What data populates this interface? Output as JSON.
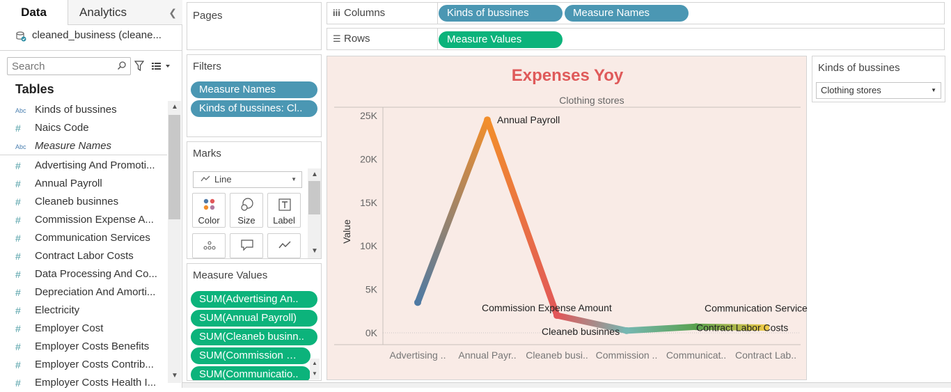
{
  "tabs": {
    "data": "Data",
    "analytics": "Analytics"
  },
  "datasource": "cleaned_business (cleane...",
  "search": {
    "placeholder": "Search"
  },
  "tables_heading": "Tables",
  "fields": [
    {
      "type": "abc",
      "label": "Kinds of bussines",
      "italic": false
    },
    {
      "type": "measure",
      "label": "Naics Code",
      "italic": false
    },
    {
      "type": "abc",
      "label": "Measure Names",
      "italic": true
    },
    {
      "type": "measure",
      "label": "Advertising And Promoti...",
      "italic": false
    },
    {
      "type": "measure",
      "label": "Annual Payroll",
      "italic": false
    },
    {
      "type": "measure",
      "label": "Cleaneb businnes",
      "italic": false
    },
    {
      "type": "measure",
      "label": "Commission Expense A...",
      "italic": false
    },
    {
      "type": "measure",
      "label": "Communication Services",
      "italic": false
    },
    {
      "type": "measure",
      "label": "Contract Labor Costs",
      "italic": false
    },
    {
      "type": "measure",
      "label": "Data Processing And Co...",
      "italic": false
    },
    {
      "type": "measure",
      "label": "Depreciation And Amorti...",
      "italic": false
    },
    {
      "type": "measure",
      "label": "Electricity",
      "italic": false
    },
    {
      "type": "measure",
      "label": "Employer Cost",
      "italic": false
    },
    {
      "type": "measure",
      "label": "Employer Costs Benefits",
      "italic": false
    },
    {
      "type": "measure",
      "label": "Employer Costs Contrib...",
      "italic": false
    },
    {
      "type": "measure",
      "label": "Employer Costs Health I...",
      "italic": false
    }
  ],
  "icons": {
    "abc": "Abc",
    "measure": "#"
  },
  "pages": {
    "title": "Pages"
  },
  "filters": {
    "title": "Filters",
    "pills": [
      "Measure Names",
      "Kinds of bussines: Cl.."
    ]
  },
  "marks": {
    "title": "Marks",
    "type": "Line",
    "buttons": [
      "Color",
      "Size",
      "Label"
    ]
  },
  "measure_values": {
    "title": "Measure Values",
    "pills": [
      "SUM(Advertising An..",
      "SUM(Annual Payroll)",
      "SUM(Cleaneb businn..",
      "SUM(Commission Ex..",
      "SUM(Communicatio.."
    ]
  },
  "shelves": {
    "columns_label": "Columns",
    "rows_label": "Rows",
    "columns_pills": [
      "Kinds of bussines",
      "Measure Names"
    ],
    "rows_pills": [
      "Measure Values"
    ]
  },
  "viz": {
    "title": "Expenses Yoy",
    "pane_header": "Clothing stores"
  },
  "filter_card": {
    "title": "Kinds of bussines",
    "value": "Clothing stores"
  },
  "colors": {
    "pill_blue": "#4b97b3",
    "pill_green": "#0cb37b",
    "title_red": "#df5a5a",
    "viz_bg": "#f9ebe6"
  },
  "chart_data": {
    "type": "line",
    "title": "Expenses Yoy",
    "ylabel": "Value",
    "xlabel": "",
    "pane_header": "Clothing stores",
    "ylim": [
      0,
      27000
    ],
    "yticks": [
      0,
      5000,
      10000,
      15000,
      20000,
      25000
    ],
    "ytick_labels": [
      "0K",
      "5K",
      "10K",
      "15K",
      "20K",
      "25K"
    ],
    "categories": [
      "Advertising ..",
      "Annual Payr..",
      "Cleaneb busi..",
      "Commission ..",
      "Communicat..",
      "Contract Lab.."
    ],
    "points": [
      {
        "label": "",
        "x": 0.5,
        "y": 3500,
        "color": "#4f7aa3"
      },
      {
        "label": "Annual Payroll",
        "x": 1.5,
        "y": 24500,
        "color": "#f28e2b"
      },
      {
        "label": "Commission Expense Amount",
        "x": 2.5,
        "y": 2000,
        "color": "#e15759"
      },
      {
        "label": "Cleaneb businnes",
        "x": 3.5,
        "y": 250,
        "color": "#76b7b2"
      },
      {
        "label": "Communication Services",
        "x": 4.5,
        "y": 700,
        "color": "#59a14f"
      },
      {
        "label": "Contract Labor Costs",
        "x": 5.5,
        "y": 600,
        "color": "#edc948"
      }
    ]
  }
}
